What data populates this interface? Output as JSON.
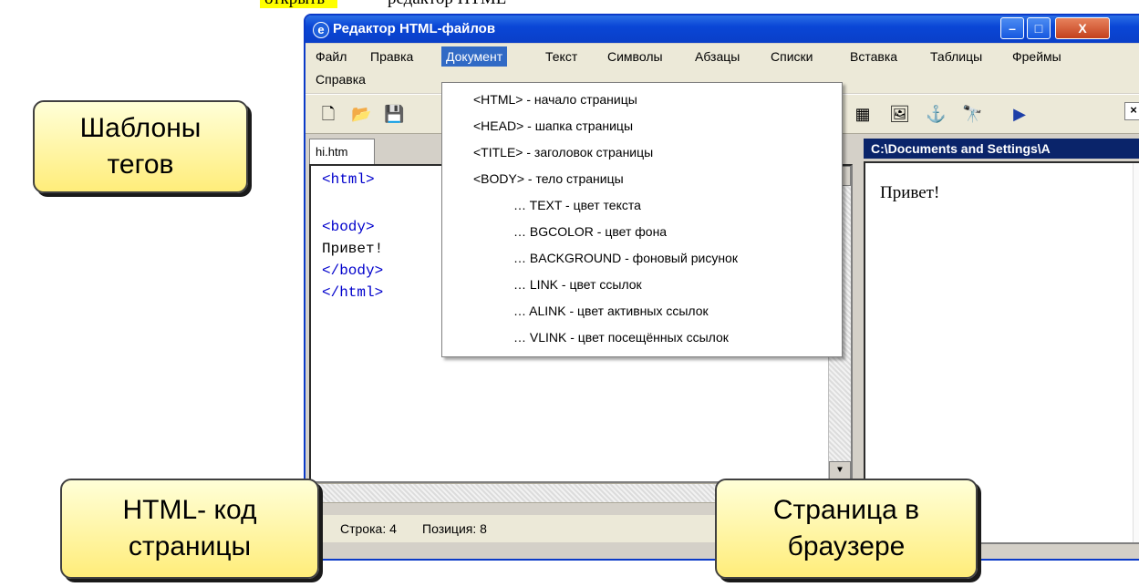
{
  "page": {
    "top_text_a": "открыть",
    "top_text_b": "редактор HTML"
  },
  "window": {
    "title": "Редактор HTML-файлов",
    "buttons": {
      "minimize": "–",
      "maximize": "□",
      "close": "X"
    }
  },
  "menu": {
    "items": [
      "Файл",
      "Правка",
      "Документ",
      "Текст",
      "Символы",
      "Абзацы",
      "Списки",
      "Вставка",
      "Таблицы",
      "Фреймы"
    ],
    "second_row": [
      "Справка"
    ],
    "active": "Документ"
  },
  "dropdown": {
    "items": [
      "<HTML> - начало страницы",
      "<HEAD> - шапка страницы",
      "<TITLE> - заголовок страницы",
      "<BODY> - тело страницы",
      "… TEXT - цвет текста",
      "… BGCOLOR - цвет фона",
      "… BACKGROUND - фоновый рисунок",
      "… LINK - цвет ссылок",
      "… ALINK - цвет активных ссылок",
      "… VLINK - цвет посещённых ссылок"
    ]
  },
  "toolbar": {
    "icons": [
      "new-file-icon",
      "open-folder-icon",
      "save-disk-icon",
      "color-palette-icon",
      "image-icon",
      "anchor-icon",
      "binoculars-icon",
      "play-arrow-icon"
    ],
    "close_label": "×"
  },
  "editor": {
    "tab": "hi.htm",
    "lines": [
      "<html>",
      "",
      "<body>",
      "Привет!",
      "</body>",
      "</html>"
    ]
  },
  "browser": {
    "path": "C:\\Documents and Settings\\A",
    "content": "Привет!"
  },
  "status": {
    "row": "Строка: 4",
    "pos": "Позиция: 8"
  },
  "callouts": {
    "templates": "Шаблоны тегов",
    "code": "HTML- код страницы",
    "page": "Страница в браузере"
  },
  "colors": {
    "titlebar": "#0a46d6",
    "menu_active": "#316ac5",
    "code_tag": "#0000cc",
    "callout_fill": "#ffed7a",
    "highlight": "#ffff00"
  }
}
